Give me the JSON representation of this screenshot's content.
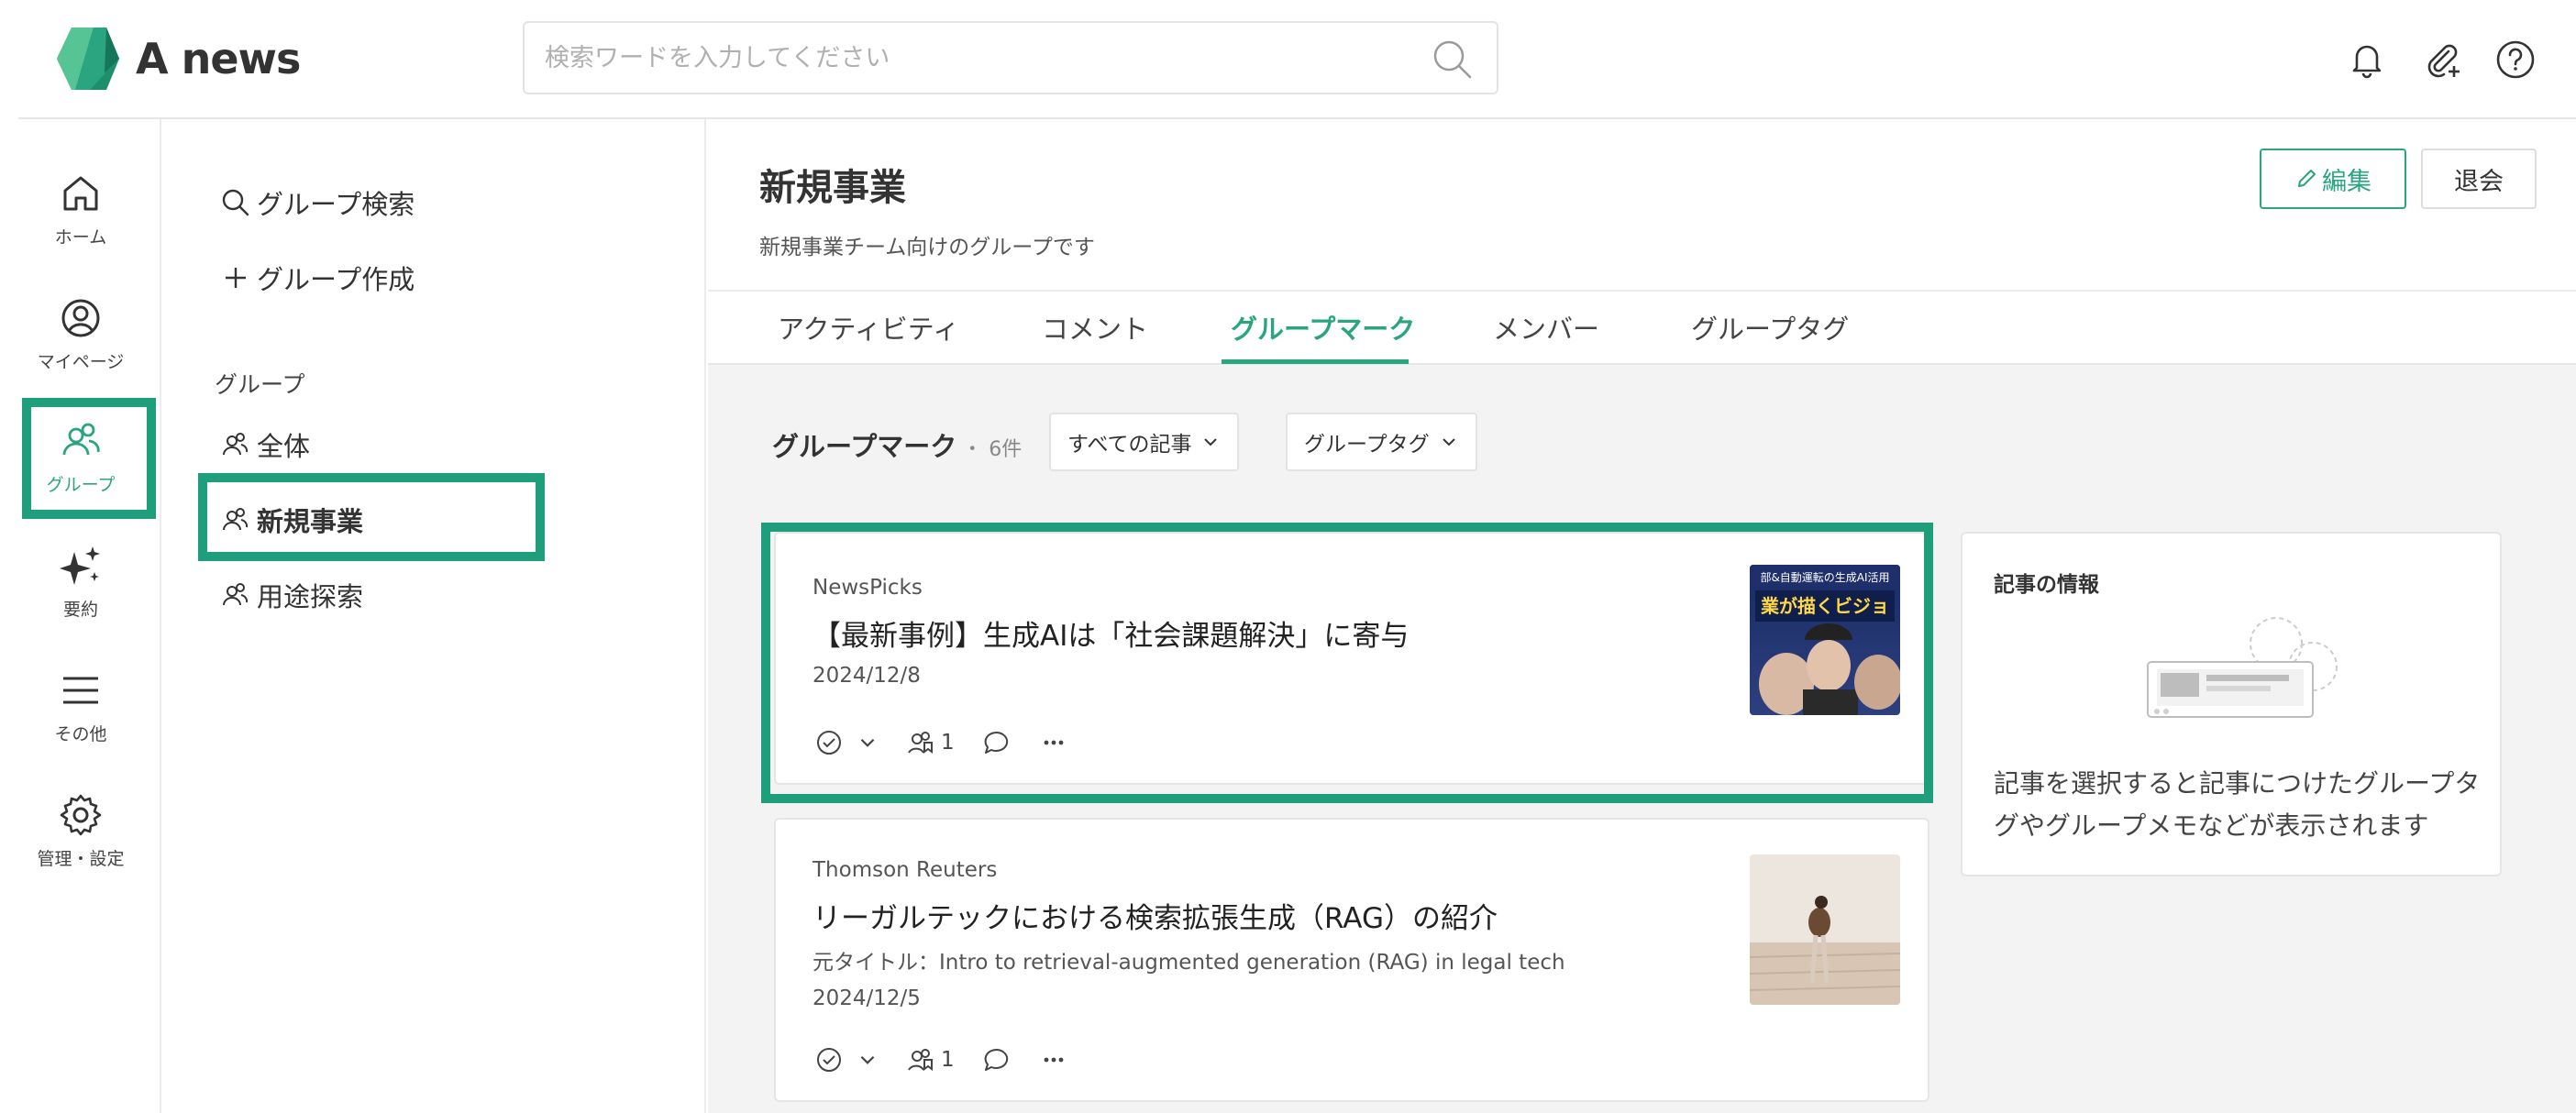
{
  "app": {
    "name": "A news"
  },
  "header": {
    "search_placeholder": "検索ワードを入力してください",
    "icons": [
      "bell-icon",
      "paperclip-add-icon",
      "help-icon"
    ]
  },
  "rail": {
    "items": [
      {
        "label": "ホーム",
        "icon": "home-icon"
      },
      {
        "label": "マイページ",
        "icon": "user-circle-icon"
      },
      {
        "label": "グループ",
        "icon": "group-icon",
        "active": true
      },
      {
        "label": "要約",
        "icon": "sparkle-icon"
      },
      {
        "label": "その他",
        "icon": "menu-icon"
      },
      {
        "label": "管理・設定",
        "icon": "gear-icon"
      }
    ]
  },
  "group_sidebar": {
    "search_label": "グループ検索",
    "create_label": "グループ作成",
    "heading": "グループ",
    "items": [
      {
        "label": "全体"
      },
      {
        "label": "新規事業",
        "active": true
      },
      {
        "label": "用途探索"
      }
    ]
  },
  "group": {
    "title": "新規事業",
    "description": "新規事業チーム向けのグループです",
    "edit_label": "編集",
    "leave_label": "退会"
  },
  "tabs": [
    {
      "label": "アクティビティ"
    },
    {
      "label": "コメント"
    },
    {
      "label": "グループマーク",
      "active": true
    },
    {
      "label": "メンバー"
    },
    {
      "label": "グループタグ"
    }
  ],
  "filter": {
    "title": "グループマーク",
    "count": "・ 6件",
    "all_articles_label": "すべての記事",
    "group_tag_label": "グループタグ"
  },
  "articles": [
    {
      "source": "NewsPicks",
      "title": "【最新事例】生成AIは「社会課題解決」に寄与",
      "date": "2024/12/8",
      "member_count": "1",
      "thumb_text": "業が描くビジョ",
      "thumb_top_text": "部&自動運転の生成AI活用"
    },
    {
      "source": "Thomson Reuters",
      "title": "リーガルテックにおける検索拡張生成（RAG）の紹介",
      "original_title": "元タイトル：Intro to retrieval-augmented generation (RAG) in legal tech",
      "date": "2024/12/5",
      "member_count": "1"
    }
  ],
  "info_panel": {
    "title": "記事の情報",
    "message": "記事を選択すると記事につけたグループタグやグループメモなどが表示されます"
  },
  "colors": {
    "accent": "#2aa57f",
    "highlight": "#1e9e7a",
    "content_bg": "#f3f3f3"
  }
}
